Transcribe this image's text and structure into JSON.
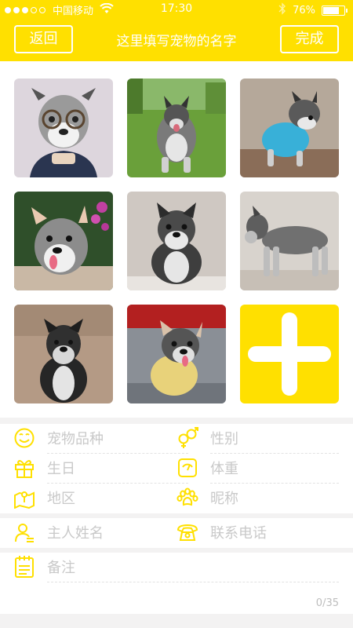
{
  "status_bar": {
    "carrier": "中国移动",
    "time": "17:30",
    "battery_text": "76%",
    "battery_level": 0.76
  },
  "nav": {
    "back_label": "返回",
    "title": "这里填写宠物的名字",
    "done_label": "完成"
  },
  "photos": [
    {
      "name": "photo-schnauzer-glasses"
    },
    {
      "name": "photo-schnauzer-running"
    },
    {
      "name": "photo-schnauzer-blue-shirt"
    },
    {
      "name": "photo-schnauzer-flowers"
    },
    {
      "name": "photo-schnauzer-sitting"
    },
    {
      "name": "photo-schnauzer-standing"
    },
    {
      "name": "photo-schnauzer-sofa"
    },
    {
      "name": "photo-schnauzer-yellow-shirt"
    }
  ],
  "add_photo_icon": "plus-icon",
  "fields": {
    "breed": "宠物品种",
    "gender": "性别",
    "birthday": "生日",
    "weight": "体重",
    "region": "地区",
    "nickname": "昵称",
    "owner_name": "主人姓名",
    "phone": "联系电话",
    "note": "备注"
  },
  "note_counter": "0/35",
  "icons": {
    "breed": "smiley-icon",
    "gender": "gender-icon",
    "birthday": "gift-icon",
    "weight": "scale-icon",
    "region": "map-icon",
    "nickname": "paw-icon",
    "owner_name": "person-icon",
    "phone": "phone-icon",
    "note": "notepad-icon"
  },
  "colors": {
    "accent": "#FFE000",
    "placeholder": "#c9c9c9"
  }
}
